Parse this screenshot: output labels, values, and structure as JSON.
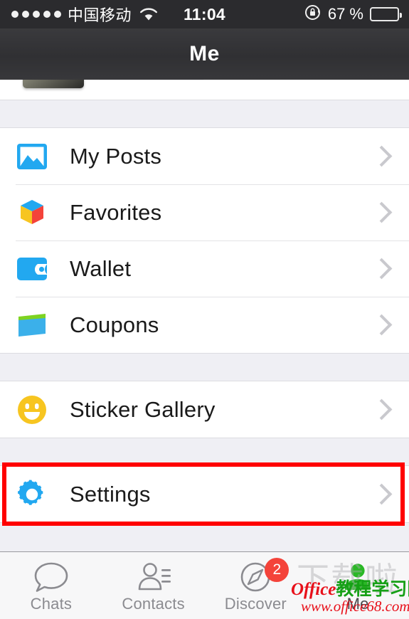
{
  "status_bar": {
    "signal_dots_filled": 5,
    "carrier": "中国移动",
    "wifi_icon": "wifi-icon",
    "time": "11:04",
    "orientation_lock_icon": "rotation-lock-icon",
    "battery_percent": "67 %",
    "battery_level": 67
  },
  "nav": {
    "title": "Me"
  },
  "groups": [
    {
      "rows": [
        {
          "label": "My Posts",
          "icon": "photo-icon",
          "color": "#22a8f0",
          "chevron": true
        },
        {
          "label": "Favorites",
          "icon": "cube-star-icon",
          "color": "#22a8f0",
          "chevron": true
        },
        {
          "label": "Wallet",
          "icon": "wallet-icon",
          "color": "#22a8f0",
          "chevron": true
        },
        {
          "label": "Coupons",
          "icon": "coupon-card-icon",
          "color": "#3bb0ea",
          "chevron": true
        }
      ]
    },
    {
      "rows": [
        {
          "label": "Sticker Gallery",
          "icon": "smiley-icon",
          "color": "#f7c520",
          "chevron": true
        }
      ]
    },
    {
      "highlighted": true,
      "highlight_color": "#ff0000",
      "rows": [
        {
          "label": "Settings",
          "icon": "gear-icon",
          "color": "#22a8f0",
          "chevron": true
        }
      ]
    }
  ],
  "tabbar": {
    "tabs": [
      {
        "label": "Chats",
        "icon": "chat-bubble-icon",
        "active": false,
        "badge": ""
      },
      {
        "label": "Contacts",
        "icon": "contacts-icon",
        "active": false,
        "badge": ""
      },
      {
        "label": "Discover",
        "icon": "compass-icon",
        "active": false,
        "badge": "2"
      },
      {
        "label": "Me",
        "icon": "person-icon",
        "active": true,
        "badge": ""
      }
    ],
    "active_color": "#2ab826",
    "inactive_color": "#8b8b90",
    "badge_color": "#f4433a"
  },
  "watermark": {
    "ghost_text": "下载啦",
    "brand_latin": "Office",
    "brand_cn": "教程学习网",
    "url": "www.office68.com"
  }
}
